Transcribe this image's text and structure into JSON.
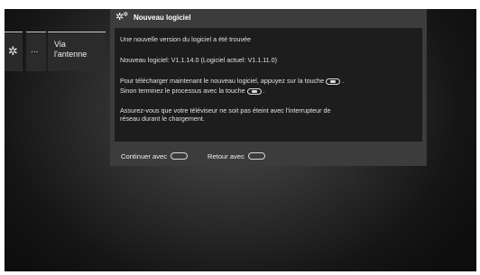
{
  "menu": {
    "items": [
      {
        "icon": "gear-icon",
        "glyph": "✲"
      },
      {
        "label": "..."
      },
      {
        "label_line1": "Via",
        "label_line2": "l'antenne"
      }
    ]
  },
  "dialog": {
    "title": "Nouveau logiciel",
    "title_icon": "gears-icon",
    "body": {
      "line1": "Une nouvelle version du logiciel a été trouvée",
      "line2": "Nouveau logiciel:  V1.1.14.0  (Logiciel actuel:  V1.1.11.0)",
      "line3_before": "Pour télécharger maintenant le nouveau logiciel, appuyez sur la touche",
      "line3_after": ".",
      "line4_before": "Sinon terminez le processus avec la touche",
      "line4_after": ".",
      "line5": "Assurez-vous que votre téléviseur ne soit pas éteint avec l'interrupteur de",
      "line6": "réseau durant le chargement."
    },
    "footer": {
      "continue_label": "Continuer avec",
      "back_label": "Retour avec",
      "continue_icon": "play-button-icon",
      "back_icon": "back-button-icon"
    }
  }
}
